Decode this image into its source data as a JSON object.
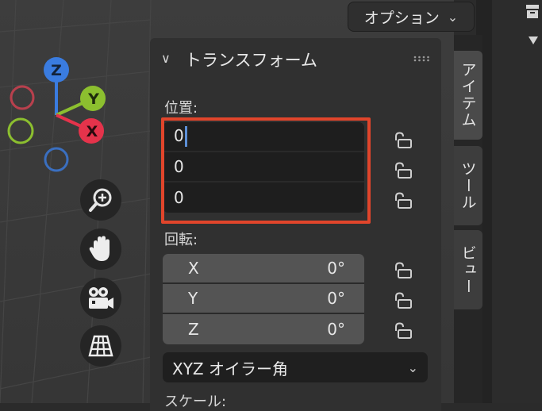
{
  "header": {
    "options_label": "オプション"
  },
  "panel": {
    "title": "トランスフォーム",
    "location_label": "位置:",
    "location": [
      "0",
      "0",
      "0"
    ],
    "rotation_label": "回転:",
    "rotation": [
      {
        "axis": "X",
        "value": "0°"
      },
      {
        "axis": "Y",
        "value": "0°"
      },
      {
        "axis": "Z",
        "value": "0°"
      }
    ],
    "rotation_mode": "XYZ オイラー角",
    "scale_label": "スケール:"
  },
  "tabs": [
    "アイテム",
    "ツール",
    "ビュー"
  ],
  "gizmo": {
    "z": "Z",
    "y": "Y",
    "x": "X"
  },
  "colors": {
    "x_axis": "#e5334b",
    "y_axis": "#8cbf2f",
    "z_axis": "#3a7ce0",
    "highlight": "#e1452b",
    "cursor": "#5c8fd6"
  }
}
